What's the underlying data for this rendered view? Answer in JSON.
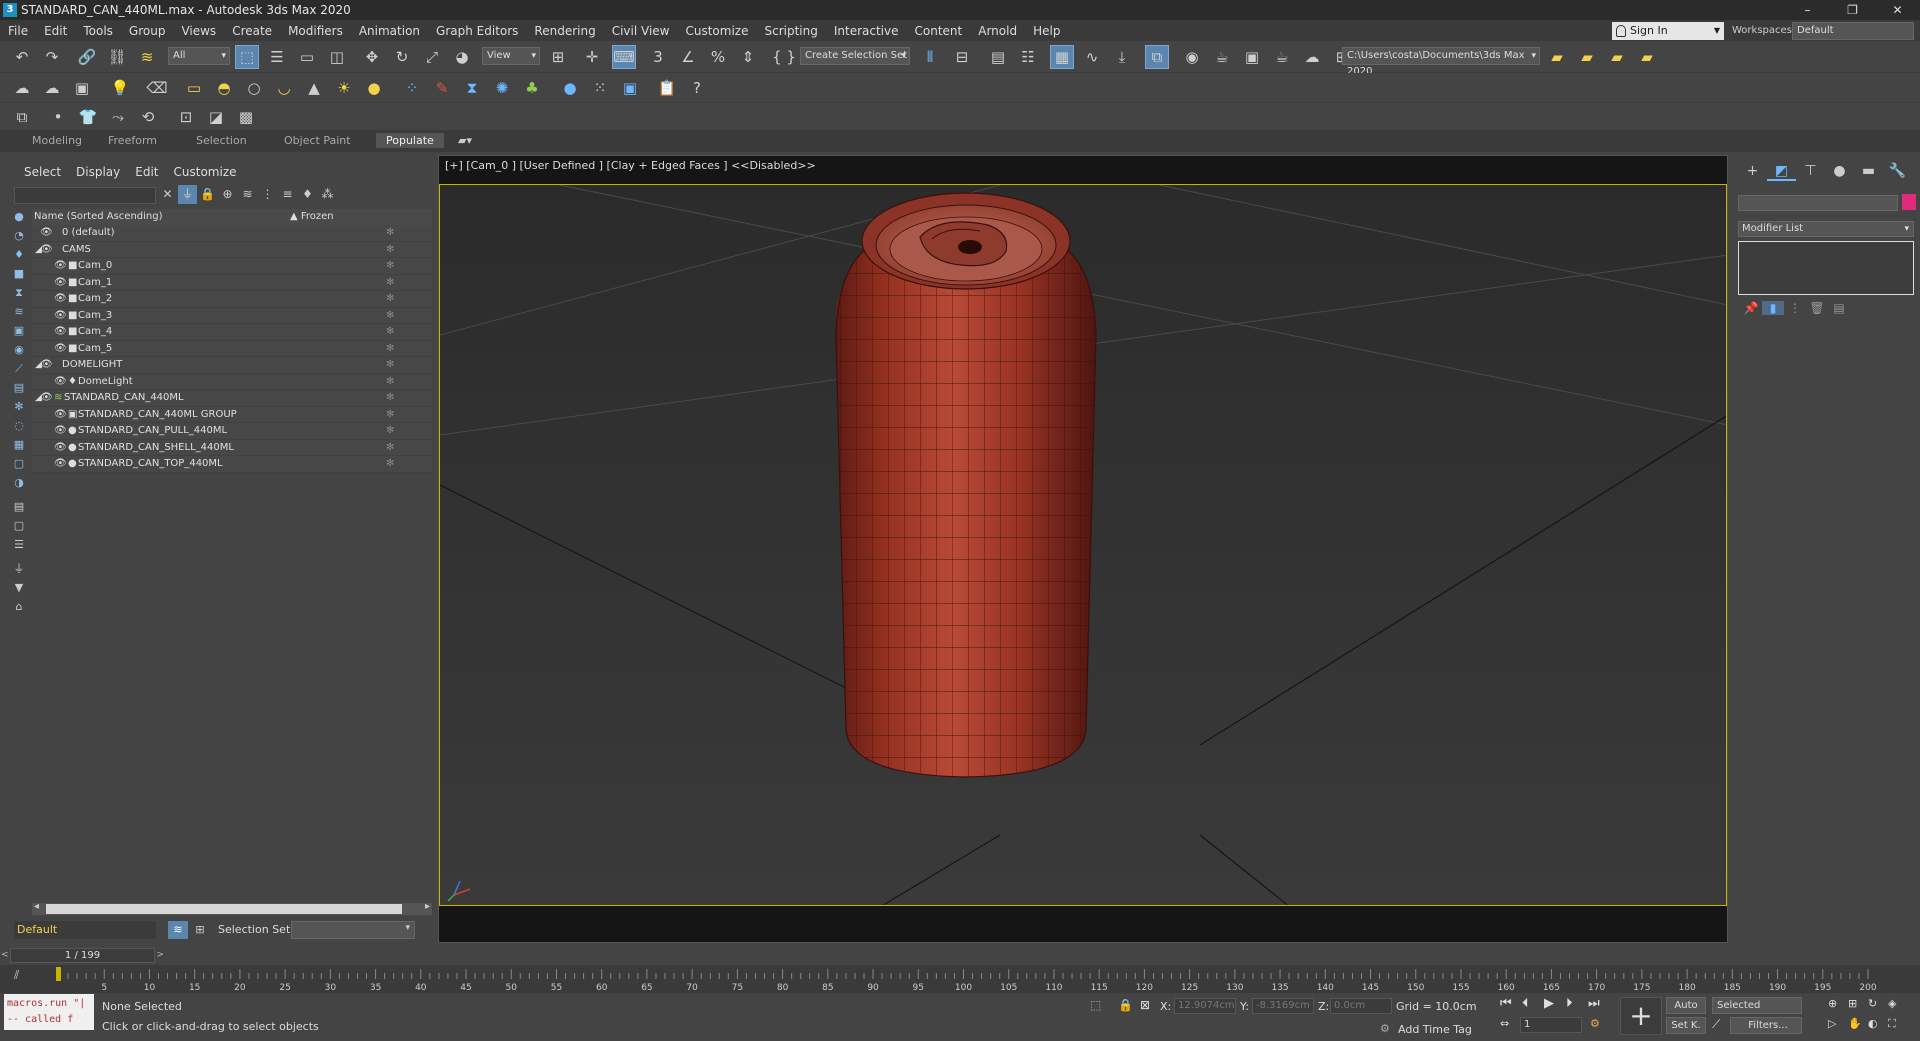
{
  "window": {
    "title": "STANDARD_CAN_440ML.max - Autodesk 3ds Max 2020",
    "app_icon": "3",
    "controls": [
      "–",
      "❐",
      "✕"
    ]
  },
  "menu": [
    "File",
    "Edit",
    "Tools",
    "Group",
    "Views",
    "Create",
    "Modifiers",
    "Animation",
    "Graph Editors",
    "Rendering",
    "Civil View",
    "Customize",
    "Scripting",
    "Interactive",
    "Content",
    "Arnold",
    "Help"
  ],
  "account": {
    "sign_in": "Sign In",
    "workspaces_label": "Workspaces:",
    "workspace_value": "Default"
  },
  "toolbar": {
    "selection_filter": "All",
    "ref_coord": "View",
    "named_selection": "Create Selection Set",
    "project_path": "C:\\Users\\costa\\Documents\\3ds Max 2020"
  },
  "ribbon_tabs": [
    "Modeling",
    "Freeform",
    "Selection",
    "Object Paint",
    "Populate"
  ],
  "ribbon_active": "Populate",
  "explorer": {
    "menu": [
      "Select",
      "Display",
      "Edit",
      "Customize"
    ],
    "header_name": "Name (Sorted Ascending)",
    "header_frozen": "▲ Frozen",
    "rows": [
      {
        "label": "0 (default)",
        "indent": 0,
        "expander": "",
        "icon": ""
      },
      {
        "label": "CAMS",
        "indent": 0,
        "expander": "◢",
        "icon": ""
      },
      {
        "label": "Cam_0",
        "indent": 1,
        "expander": "",
        "icon": "■"
      },
      {
        "label": "Cam_1",
        "indent": 1,
        "expander": "",
        "icon": "■"
      },
      {
        "label": "Cam_2",
        "indent": 1,
        "expander": "",
        "icon": "■"
      },
      {
        "label": "Cam_3",
        "indent": 1,
        "expander": "",
        "icon": "■"
      },
      {
        "label": "Cam_4",
        "indent": 1,
        "expander": "",
        "icon": "■"
      },
      {
        "label": "Cam_5",
        "indent": 1,
        "expander": "",
        "icon": "■"
      },
      {
        "label": "DOMELIGHT",
        "indent": 0,
        "expander": "◢",
        "icon": ""
      },
      {
        "label": "DomeLight",
        "indent": 1,
        "expander": "",
        "icon": "♦"
      },
      {
        "label": "STANDARD_CAN_440ML",
        "indent": 0,
        "expander": "◢",
        "icon": "≋"
      },
      {
        "label": "STANDARD_CAN_440ML GROUP",
        "indent": 1,
        "expander": "",
        "icon": "▣"
      },
      {
        "label": "STANDARD_CAN_PULL_440ML",
        "indent": 1,
        "expander": "",
        "icon": "●"
      },
      {
        "label": "STANDARD_CAN_SHELL_440ML",
        "indent": 1,
        "expander": "",
        "icon": "●"
      },
      {
        "label": "STANDARD_CAN_TOP_440ML",
        "indent": 1,
        "expander": "",
        "icon": "●"
      }
    ]
  },
  "layer": {
    "current": "Default",
    "selection_set_label": "Selection Set:"
  },
  "viewport": {
    "label": "[+] [Cam_0 ] [User Defined ] [Clay + Edged Faces ]  <<Disabled>>",
    "border_color": "#c8b400",
    "can_color": "#9e2f24"
  },
  "command_panel": {
    "modifier_list": "Modifier List",
    "object_color": "#e02a7a"
  },
  "timeline": {
    "frame_indicator": "1 / 199",
    "ticks": [
      5,
      10,
      15,
      20,
      25,
      30,
      35,
      40,
      45,
      50,
      55,
      60,
      65,
      70,
      75,
      80,
      85,
      90,
      95,
      100,
      105,
      110,
      115,
      120,
      125,
      130,
      135,
      140,
      145,
      150,
      155,
      160,
      165,
      170,
      175,
      180,
      185,
      190,
      195,
      200
    ]
  },
  "status": {
    "maxscript_line1": "macros.run \"|",
    "maxscript_line2": "-- called f",
    "selection": "None Selected",
    "prompt": "Click or click-and-drag to select objects",
    "x_label": "X:",
    "x_value": "12.9074cm",
    "y_label": "Y:",
    "y_value": "-8.3169cm",
    "z_label": "Z:",
    "z_value": "0.0cm",
    "grid": "Grid = 10.0cm",
    "add_time_tag": "Add Time Tag",
    "current_frame": "1",
    "auto_key": "Auto",
    "set_key": "Set K.",
    "key_filter_sel": "Selected",
    "filters": "Filters..."
  }
}
